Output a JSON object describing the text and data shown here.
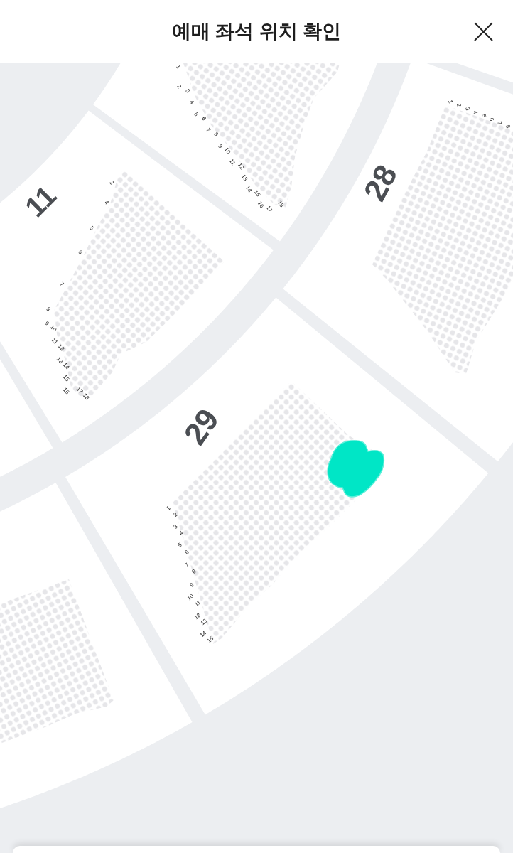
{
  "header": {
    "title": "예매 좌석 위치 확인"
  },
  "map": {
    "sections": [
      {
        "rows": [
          "1",
          "2",
          "3",
          "4",
          "5",
          "6",
          "7",
          "8",
          "9",
          "10",
          "11",
          "12",
          "13",
          "14",
          "15",
          "16",
          "17",
          "18"
        ],
        "highlighted": false
      },
      {
        "number": "11",
        "rows": [
          "3",
          "4",
          "5",
          "6",
          "7",
          "8",
          "9",
          "10",
          "11",
          "12",
          "13",
          "14",
          "15",
          "16",
          "17",
          "18"
        ],
        "highlighted": false
      },
      {
        "number": "28",
        "rows": [
          "1",
          "2",
          "3",
          "4",
          "5",
          "6",
          "7",
          "8"
        ],
        "highlighted": false
      },
      {
        "number": "29",
        "rows": [
          "1",
          "2",
          "3",
          "4",
          "5",
          "6",
          "7",
          "8",
          "9",
          "10",
          "11",
          "12",
          "13",
          "14",
          "15"
        ],
        "highlighted": true
      }
    ]
  }
}
